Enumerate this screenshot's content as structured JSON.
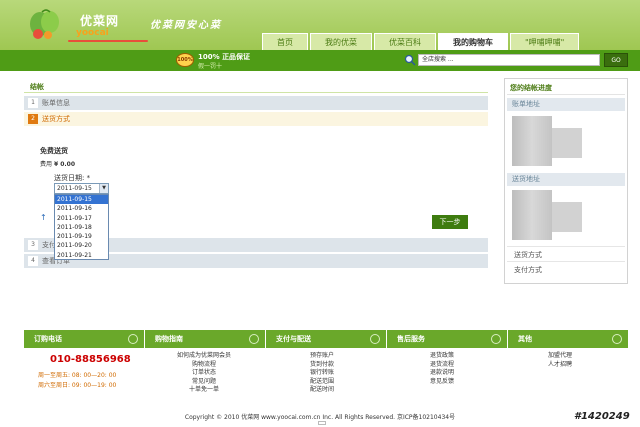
{
  "header": {
    "logo_cn": "优菜网",
    "logo_en": "yoocai",
    "slogan": "优菜网安心菜",
    "nav": [
      {
        "label": "首页",
        "active": false
      },
      {
        "label": "我的优菜",
        "active": false
      },
      {
        "label": "优菜百科",
        "active": false
      },
      {
        "label": "我的购物车",
        "active": true
      },
      {
        "label": "\"呷哺呷哺\"",
        "active": false
      }
    ],
    "badge": "100%",
    "guarantee_line1": "100% 正品保证",
    "guarantee_line2": "假一罚十",
    "search_placeholder": "全店搜索 ...",
    "go_label": "GO"
  },
  "checkout": {
    "title": "结帐",
    "steps": [
      {
        "num": "1",
        "label": "账单信息",
        "active": false
      },
      {
        "num": "2",
        "label": "送货方式",
        "active": true
      },
      {
        "num": "3",
        "label": "支付信息",
        "active": false
      },
      {
        "num": "4",
        "label": "查看订单",
        "active": false
      }
    ],
    "shipping_title": "免费送货",
    "fee_label": "费用",
    "fee_value": "¥ 0.00",
    "date_label": "送货日期: *",
    "selected_date": "2011-09-15",
    "date_options": [
      "2011-09-15",
      "2011-09-16",
      "2011-09-17",
      "2011-09-18",
      "2011-09-19",
      "2011-09-20",
      "2011-09-21"
    ],
    "back_icon": "↑",
    "next_label": "下一步"
  },
  "sidebar": {
    "title": "您的结帐进度",
    "billing_head": "账单地址",
    "shipping_head": "送货地址",
    "link_shipping_method": "送货方式",
    "link_payment_method": "支付方式"
  },
  "footer": {
    "columns": [
      "订购电话",
      "购物指南",
      "支付与配送",
      "售后服务",
      "其他"
    ],
    "phone": "010-88856968",
    "hours_weekday": "周一至周五: 08: 00—20: 00",
    "hours_weekend": "周六至周日: 09: 00—19: 00",
    "guide_links": [
      "如何成为优菜网会员",
      "购物流程",
      "订单状态",
      "常见问题",
      "十单免一单"
    ],
    "payment_links": [
      "预存账户",
      "货到付款",
      "银行转账",
      "配送范围",
      "配送时间"
    ],
    "service_links": [
      "退货政策",
      "退货流程",
      "退款说明",
      "意见反馈"
    ],
    "other_links": [
      "加盟代理",
      "人才招聘"
    ],
    "copyright": "Copyright © 2010 优菜网 www.yoocai.com.cn Inc. All Rights Reserved. 京ICP备10210434号",
    "watermark": "#1420249"
  }
}
